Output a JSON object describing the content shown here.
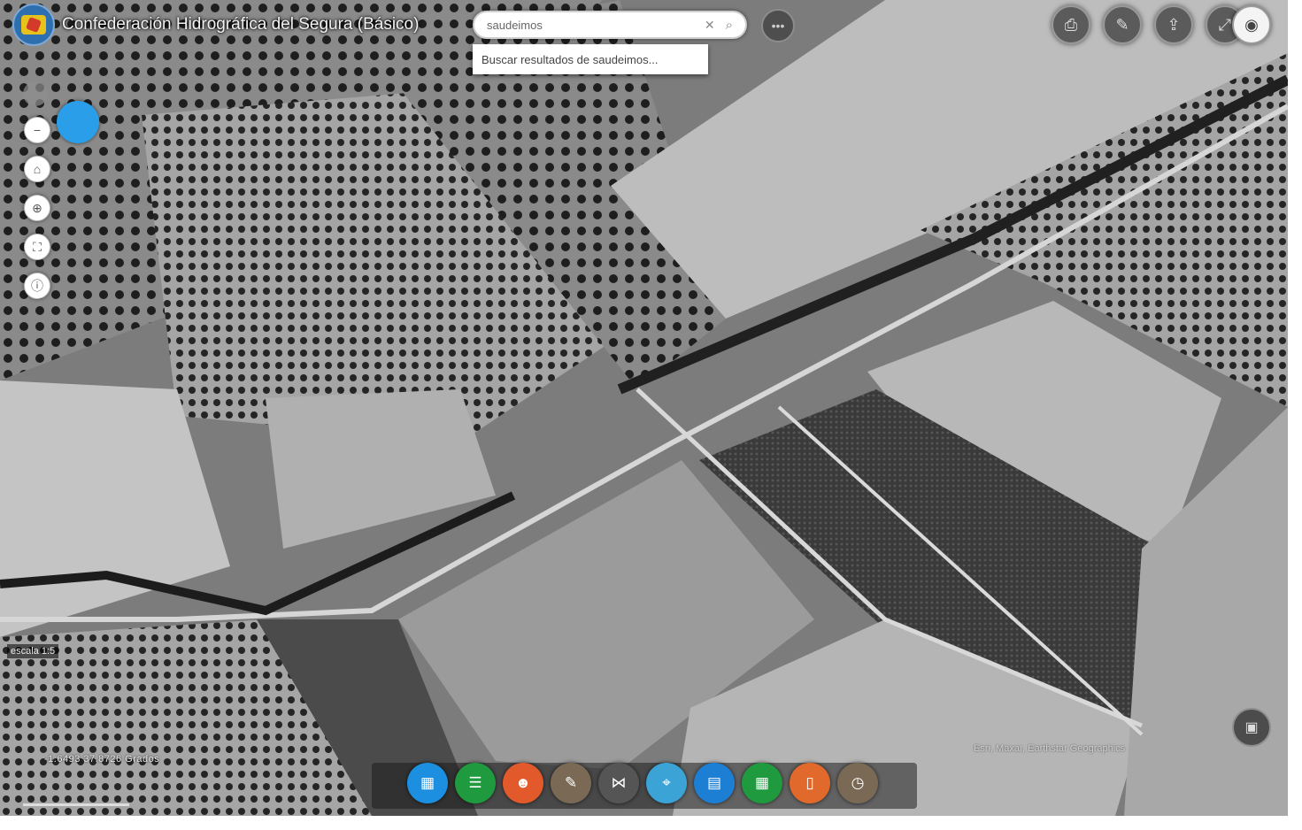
{
  "app": {
    "title": "Confederación Hidrográfica del Segura (Básico)"
  },
  "search": {
    "value": "saudeimos",
    "suggestion": "Buscar resultados de saudeimos..."
  },
  "top_toolbar": [
    {
      "name": "print-icon",
      "glyph": "⎙"
    },
    {
      "name": "measure-icon",
      "glyph": "✎"
    },
    {
      "name": "share-icon",
      "glyph": "⇪"
    },
    {
      "name": "share-icon-2",
      "glyph": "⤢"
    },
    {
      "name": "eye-icon",
      "glyph": "◉"
    }
  ],
  "left_toolbar": [
    {
      "name": "zoom-out-icon",
      "glyph": "−"
    },
    {
      "name": "home-icon",
      "glyph": "⌂"
    },
    {
      "name": "locate-icon",
      "glyph": "⊕"
    },
    {
      "name": "fullscreen-icon",
      "glyph": "⛶"
    },
    {
      "name": "info-icon",
      "glyph": "ⓘ"
    }
  ],
  "bottom_toolbar": [
    {
      "name": "map-icon",
      "color": "#1d8fe0",
      "glyph": "▦"
    },
    {
      "name": "table-icon",
      "color": "#1f9a3e",
      "glyph": "☰"
    },
    {
      "name": "user-icon",
      "color": "#e2592b",
      "glyph": "☻"
    },
    {
      "name": "draw-icon",
      "color": "#7a6a55",
      "glyph": "✎"
    },
    {
      "name": "share-nodes-icon",
      "color": "#555555",
      "glyph": "⋈"
    },
    {
      "name": "location-icon",
      "color": "#3ca3d6",
      "glyph": "⌖"
    },
    {
      "name": "chart-icon",
      "color": "#1d7fd4",
      "glyph": "▤"
    },
    {
      "name": "grid-icon",
      "color": "#1f9a3e",
      "glyph": "▦"
    },
    {
      "name": "document-icon",
      "color": "#e0692b",
      "glyph": "▯"
    },
    {
      "name": "time-icon",
      "color": "#7a6a55",
      "glyph": "◷"
    }
  ],
  "map": {
    "scale_label": "escala 1:5",
    "coordinates": "-1.6493 37.8726 Grados",
    "attribution": "Esri, Maxar, Earthstar Geographics"
  }
}
